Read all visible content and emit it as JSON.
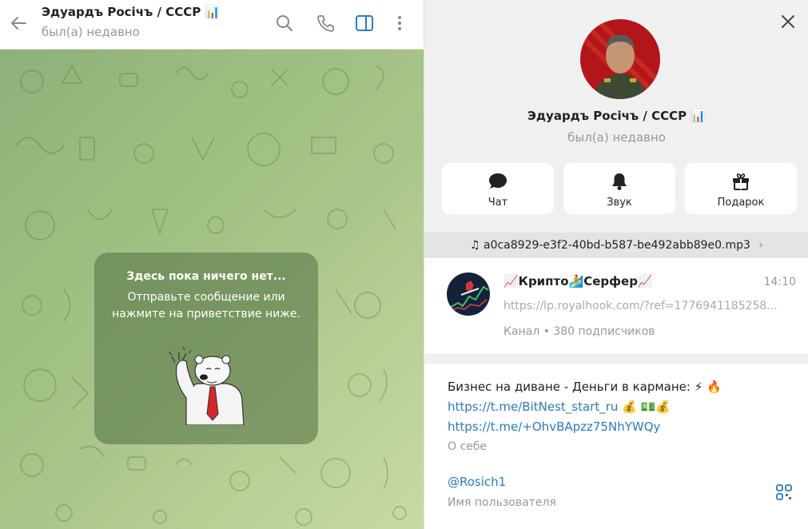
{
  "chat_header": {
    "title": "Эдуардъ Росічъ / СССР",
    "status": "был(а) недавно"
  },
  "empty_state": {
    "title": "Здесь пока ничего нет...",
    "text": "Отправьте сообщение или нажмите на приветствие ниже."
  },
  "profile": {
    "name": "Эдуардъ Росічъ / СССР",
    "status": "был(а) недавно",
    "actions": [
      {
        "label": "Чат",
        "icon": "chat-icon"
      },
      {
        "label": "Звук",
        "icon": "bell-icon"
      },
      {
        "label": "Подарок",
        "icon": "gift-icon"
      }
    ],
    "music": "♫ a0ca8929-e3f2-40bd-b587-be492abb89e0.mp3",
    "channel": {
      "name": "📈Крипто🏄Серфер📈",
      "time": "14:10",
      "link": "https://lp.royalhook.com/?ref=1776941185258...",
      "meta": "Канал • 380 подписчиков"
    },
    "bio": {
      "line1": "Бизнес на диване - Деньги в кармане: ⚡ 🔥",
      "link1": "https://t.me/BitNest_start_ru",
      "link1_suffix": " 💰 💵💰",
      "link2": "https://t.me/+OhvBApzz75NhYWQy",
      "bio_label": "О себе",
      "username": "@Rosich1",
      "username_label": "Имя пользователя"
    }
  },
  "colors": {
    "accent": "#2a7bbf",
    "chat_bg": "#a5c287",
    "empty_card": "#58764699"
  }
}
